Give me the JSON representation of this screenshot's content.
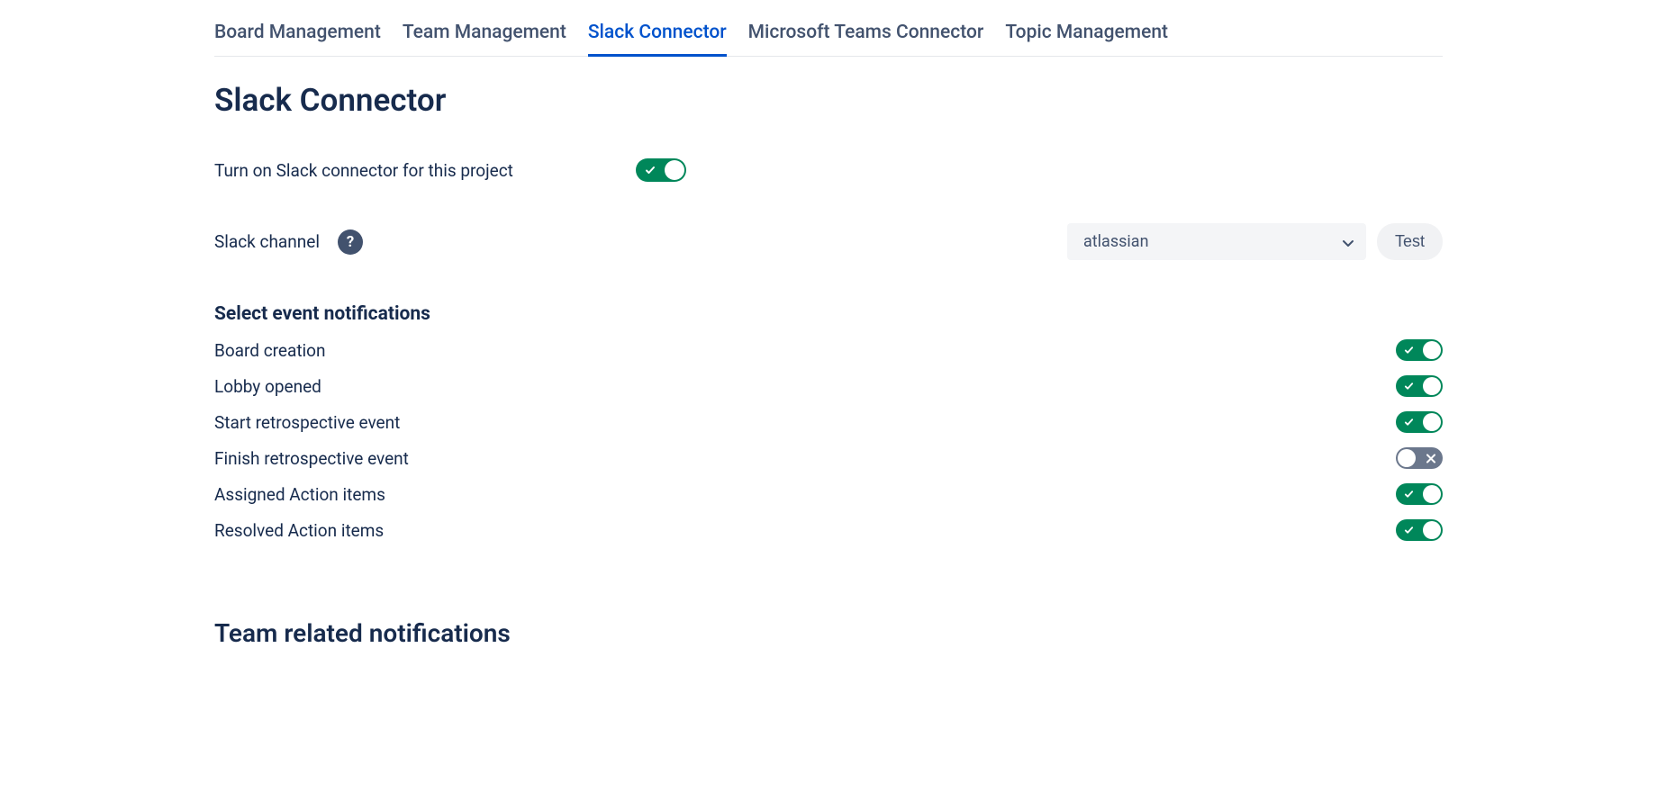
{
  "tabs": [
    {
      "label": "Board Management",
      "active": false
    },
    {
      "label": "Team Management",
      "active": false
    },
    {
      "label": "Slack Connector",
      "active": true
    },
    {
      "label": "Microsoft Teams Connector",
      "active": false
    },
    {
      "label": "Topic Management",
      "active": false
    }
  ],
  "page_title": "Slack Connector",
  "enable_label": "Turn on Slack connector for this project",
  "enable_toggle": true,
  "channel": {
    "label": "Slack channel",
    "selected": "atlassian",
    "test_button": "Test"
  },
  "notifications": {
    "header": "Select event notifications",
    "items": [
      {
        "label": "Board creation",
        "enabled": true
      },
      {
        "label": "Lobby opened",
        "enabled": true
      },
      {
        "label": "Start retrospective event",
        "enabled": true
      },
      {
        "label": "Finish retrospective event",
        "enabled": false
      },
      {
        "label": "Assigned Action items",
        "enabled": true
      },
      {
        "label": "Resolved Action items",
        "enabled": true
      }
    ]
  },
  "team_section_title": "Team related notifications"
}
